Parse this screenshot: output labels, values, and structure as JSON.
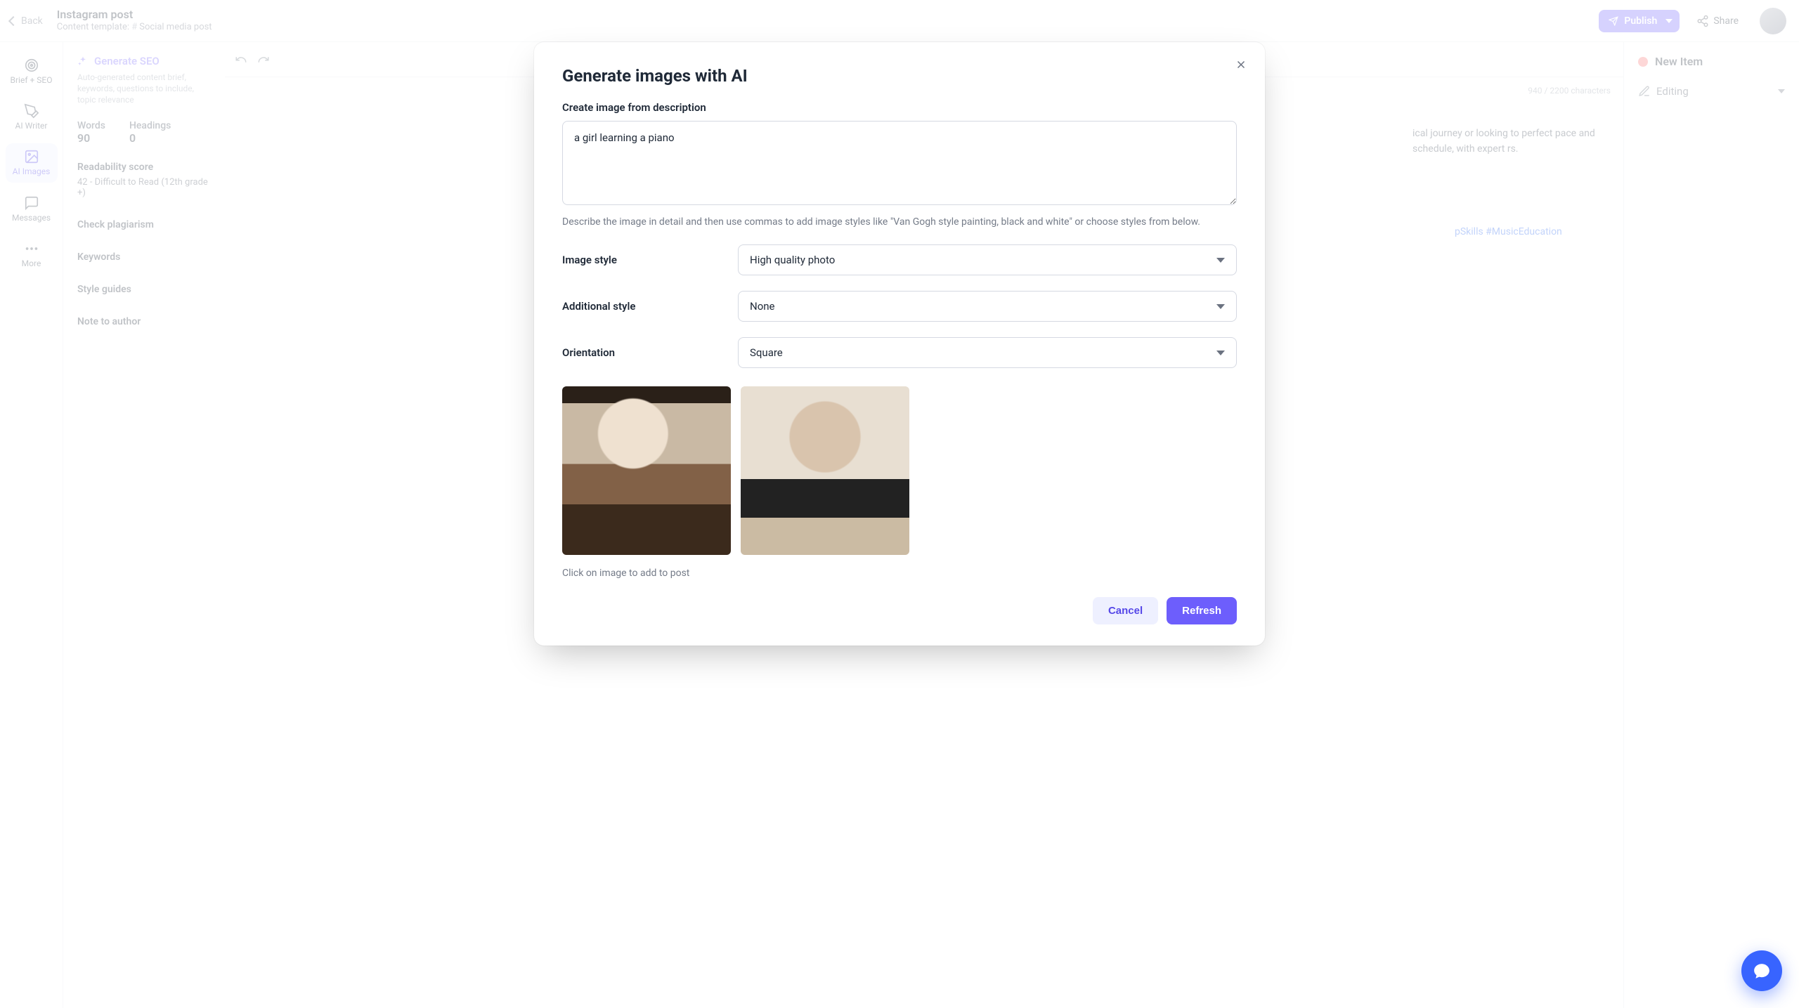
{
  "header": {
    "back_label": "Back",
    "title": "Instagram post",
    "template_prefix": "Content template:",
    "template_name": "Social media post",
    "publish_label": "Publish",
    "share_label": "Share"
  },
  "rail": {
    "items": [
      {
        "key": "brief",
        "label": "Brief + SEO"
      },
      {
        "key": "aiwriter",
        "label": "AI Writer"
      },
      {
        "key": "aiimages",
        "label": "AI Images"
      },
      {
        "key": "messages",
        "label": "Messages"
      },
      {
        "key": "more",
        "label": "More"
      }
    ]
  },
  "left_panel": {
    "generate_seo_label": "Generate SEO",
    "generate_seo_desc": "Auto-generated content brief, keywords, questions to include, topic relevance",
    "words_label": "Words",
    "words_value": "90",
    "headings_label": "Headings",
    "headings_value": "0",
    "readability_label": "Readability score",
    "readability_value": "42 - Difficult to Read (12th grade +)",
    "check_plagiarism_label": "Check plagiarism",
    "keywords_label": "Keywords",
    "style_guides_label": "Style guides",
    "note_to_author_label": "Note to author"
  },
  "right_panel": {
    "new_item_label": "New Item",
    "editing_label": "Editing"
  },
  "editor": {
    "char_counter": "940 / 2200 characters",
    "snippet_text": "ical journey or looking to perfect pace and schedule, with expert rs.",
    "hashtag_tail": "pSkills #MusicEducation"
  },
  "modal": {
    "title": "Generate images with AI",
    "desc_label": "Create image from description",
    "desc_value": "a girl learning a piano",
    "desc_hint": "Describe the image in detail and then use commas to add image styles like \"Van Gogh style painting, black and white\" or choose styles from below.",
    "image_style_label": "Image style",
    "image_style_value": "High quality photo",
    "additional_style_label": "Additional style",
    "additional_style_value": "None",
    "orientation_label": "Orientation",
    "orientation_value": "Square",
    "thumb_hint": "Click on image to add to post",
    "cancel_label": "Cancel",
    "refresh_label": "Refresh"
  }
}
